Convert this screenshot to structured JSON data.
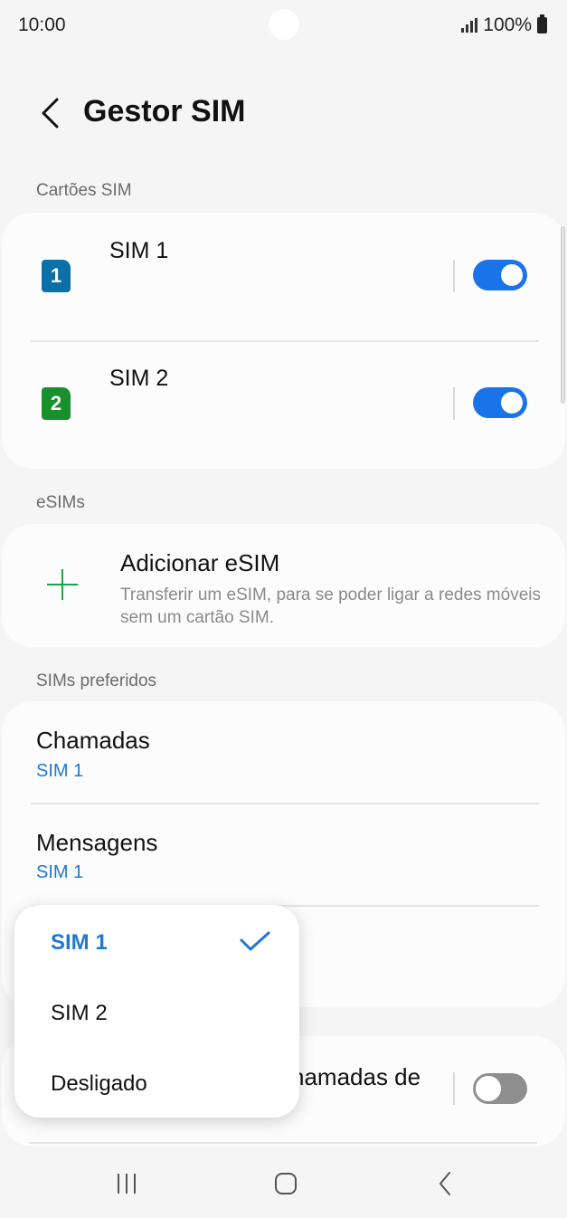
{
  "status_bar": {
    "time": "10:00",
    "battery": "100%"
  },
  "header": {
    "title": "Gestor SIM"
  },
  "sections": {
    "sim_cards": "Cartões SIM",
    "esims": "eSIMs",
    "preferred": "SIMs preferidos"
  },
  "sims": [
    {
      "badge": "1",
      "name": "SIM 1",
      "enabled": true,
      "color": "#0b6fa8"
    },
    {
      "badge": "2",
      "name": "SIM 2",
      "enabled": true,
      "color": "#1a8f2e"
    }
  ],
  "esim": {
    "title": "Adicionar eSIM",
    "description": "Transferir um eSIM, para se poder ligar a redes móveis sem um cartão SIM."
  },
  "preferred": {
    "calls": {
      "title": "Chamadas",
      "value": "SIM 1"
    },
    "messages": {
      "title": "Mensagens",
      "value": "SIM 1"
    }
  },
  "background_partial": {
    "calls_setting_fragment": "hamadas de",
    "toggle_enabled": false
  },
  "popup": {
    "options": [
      "SIM 1",
      "SIM 2",
      "Desligado"
    ],
    "selected": "SIM 1"
  },
  "colors": {
    "accent": "#1f78d1",
    "toggle_on": "#1a73e8"
  },
  "nav_icons": [
    "recent-apps-icon",
    "home-icon",
    "back-icon"
  ]
}
